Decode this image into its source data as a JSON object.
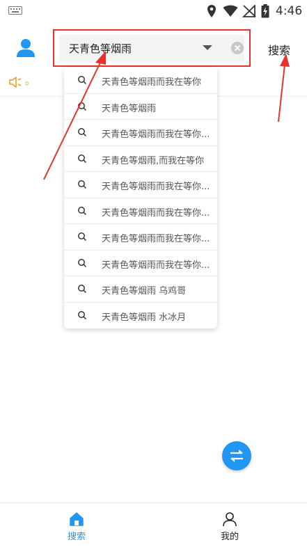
{
  "status_bar": {
    "time": "4:46",
    "icons": [
      "keyboard-icon",
      "location-icon",
      "wifi-icon",
      "signal-off-icon",
      "battery-charging-icon"
    ]
  },
  "header": {
    "search": {
      "value": "天青色等烟雨",
      "dropdown_icon": "caret-down-icon",
      "clear_icon": "clear-icon"
    },
    "search_button_label": "搜索",
    "avatar_icon": "user-icon"
  },
  "notice": {
    "icon": "speaker-icon",
    "text": "。"
  },
  "suggestions": [
    "天青色等烟雨而我在等你",
    "天青色等烟雨",
    "天青色等烟雨而我在等你...",
    "天青色等烟雨,而我在等你",
    "天青色等烟雨而我在等你...",
    "天青色等烟雨而我在等你...",
    "天青色等烟雨而我在等你...",
    "天青色等烟雨而我在等你...",
    "天青色等烟雨 乌鸡哥",
    "天青色等烟雨 水冰月"
  ],
  "fab": {
    "icon": "swap-icon"
  },
  "bottom_nav": {
    "items": [
      {
        "label": "搜索",
        "icon": "home-icon",
        "active": true
      },
      {
        "label": "我的",
        "icon": "person-icon",
        "active": false
      }
    ]
  },
  "colors": {
    "accent": "#2196f3",
    "highlight_border": "#e5332a",
    "annotation_arrow": "#e5332a",
    "notice": "#e5a22a"
  }
}
